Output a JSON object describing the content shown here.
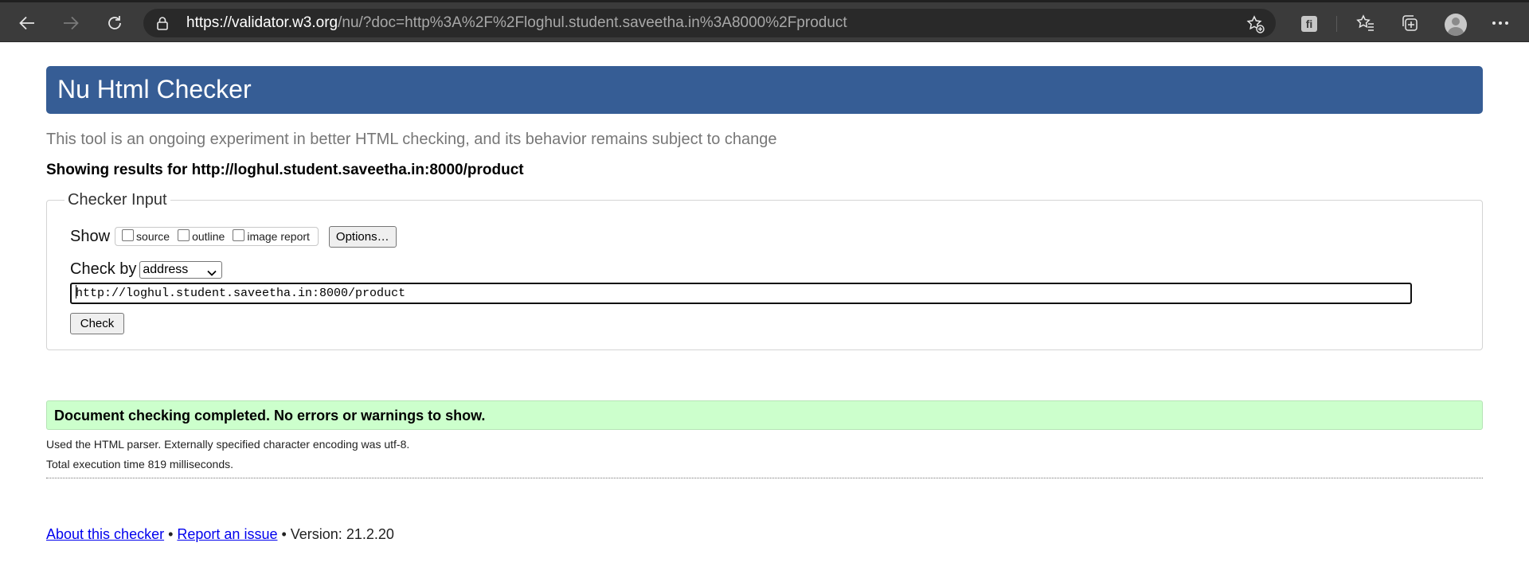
{
  "browser": {
    "url_host": "https://validator.w3.org",
    "url_rest": "/nu/?doc=http%3A%2F%2Floghul.student.saveetha.in%3A8000%2Fproduct",
    "icons": [
      "back-arrow-icon",
      "forward-arrow-icon",
      "refresh-icon",
      "lock-icon",
      "favorite-add-icon",
      "extension-icon",
      "favorites-icon",
      "collections-icon",
      "profile-avatar-icon",
      "more-icon"
    ],
    "extension_label": "fi"
  },
  "page": {
    "banner_title": "Nu Html Checker",
    "banner_color": "#365d95",
    "subtitle": "This tool is an ongoing experiment in better HTML checking, and its behavior remains subject to change",
    "results_title": "Showing results for http://loghul.student.saveetha.in:8000/product"
  },
  "checker": {
    "legend": "Checker Input",
    "show_label": "Show",
    "options": [
      {
        "label": "source",
        "checked": false
      },
      {
        "label": "outline",
        "checked": false
      },
      {
        "label": "image report",
        "checked": false
      }
    ],
    "options_button": "Options…",
    "check_by_label": "Check by",
    "check_by_value": "address",
    "url_value": "http://loghul.student.saveetha.in:8000/product",
    "check_button": "Check"
  },
  "result": {
    "message": "Document checking completed. No errors or warnings to show.",
    "message_bg": "#ccffcc",
    "parser_info": "Used the HTML parser. Externally specified character encoding was utf-8.",
    "time_info": "Total execution time 819 milliseconds."
  },
  "footer": {
    "about_link": "About this checker",
    "sep1": " • ",
    "report_link": "Report an issue",
    "version_text": " • Version: 21.2.20"
  }
}
